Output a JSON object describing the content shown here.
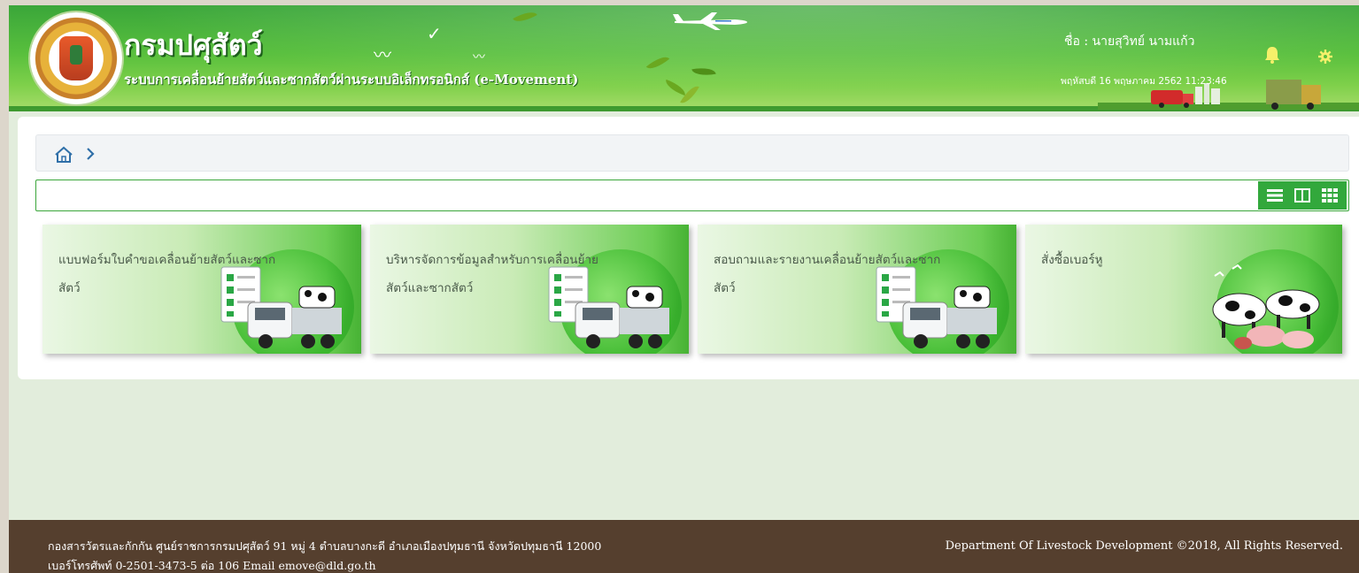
{
  "header": {
    "org_name": "กรมปศุสัตว์",
    "system_name": "ระบบการเคลื่อนย้ายสัตว์และซากสัตว์ผ่านระบบอิเล็กทรอนิกส์ (e-Movement)",
    "user_label": "ชื่อ : นายสุวิทย์ นามแก้ว",
    "datetime": "พฤหัสบดี 16 พฤษภาคม 2562 11:23:46"
  },
  "search": {
    "value": "",
    "placeholder": ""
  },
  "view_toggle": [
    "list-view-icon",
    "split-view-icon",
    "grid-view-icon"
  ],
  "tiles": [
    {
      "title": "แบบฟอร์มใบคำขอเคลื่อนย้ายสัตว์และซากสัตว์",
      "icon": "truck-checklist-icon"
    },
    {
      "title": "บริหารจัดการข้อมูลสำหรับการเคลื่อนย้ายสัตว์และซากสัตว์",
      "icon": "truck-checklist-icon"
    },
    {
      "title": "สอบถามและรายงานเคลื่อนย้ายสัตว์และซากสัตว์",
      "icon": "truck-checklist-icon"
    },
    {
      "title": "สั่งซื้อเบอร์หู",
      "icon": "livestock-icon"
    }
  ],
  "footer": {
    "address": "กองสารวัตรและกักกัน ศูนย์ราชการกรมปศุสัตว์ 91 หมู่ 4 ตำบลบางกะดี อำเภอเมืองปทุมธานี จังหวัดปทุมธานี 12000",
    "contact": "เบอร์โทรศัพท์ 0-2501-3473-5 ต่อ 106 Email emove@dld.go.th",
    "copyright": "Department Of Livestock Development ©2018, All Rights Reserved."
  },
  "colors": {
    "header_green": "#3aa63a",
    "footer_brown": "#553f2e",
    "accent_green": "#32a83c"
  }
}
